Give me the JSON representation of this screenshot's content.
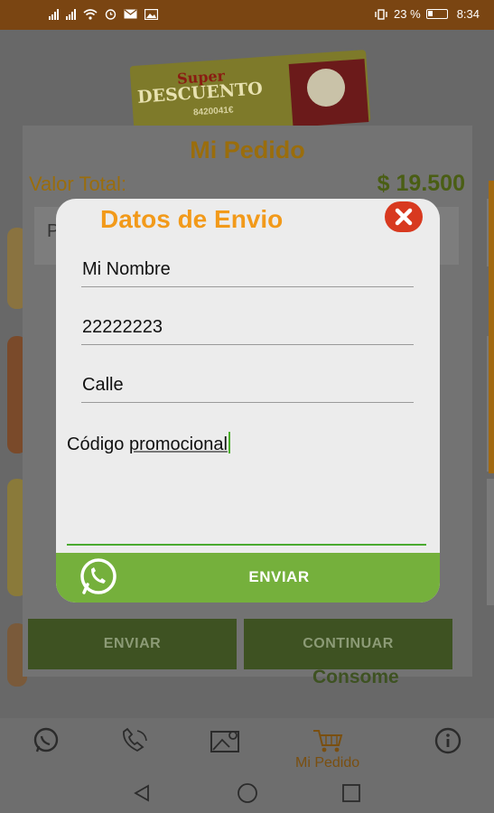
{
  "status_bar": {
    "battery_percent": "23 %",
    "time": "8:34"
  },
  "background": {
    "logo": {
      "super": "Super",
      "descuento": "DESCUENTO",
      "phone": "8420041€"
    },
    "order_dialog": {
      "title": "Mi Pedido",
      "total_label": "Valor Total:",
      "total_value": "$ 19.500",
      "item_partial": "P",
      "enviar_button": "ENVIAR",
      "continuar_button": "CONTINUAR"
    },
    "consome_text": "Consome"
  },
  "envio_dialog": {
    "title": "Datos de Envio",
    "fields": {
      "name": "Mi Nombre",
      "phone": "22222223",
      "address": "Calle"
    },
    "promo": {
      "word1": "Código",
      "word2": "promocional"
    },
    "send_label": "ENVIAR"
  },
  "bottom_nav": {
    "items": [
      {
        "icon": "whatsapp-icon",
        "label": ""
      },
      {
        "icon": "phone-icon",
        "label": ""
      },
      {
        "icon": "map-icon",
        "label": ""
      },
      {
        "icon": "cart-icon",
        "label": "Mi Pedido"
      },
      {
        "icon": "info-icon",
        "label": ""
      }
    ]
  },
  "colors": {
    "accent_orange": "#f29a1a",
    "send_green": "#75b03c",
    "close_red": "#d8391f",
    "status_brown": "#7a4512"
  }
}
